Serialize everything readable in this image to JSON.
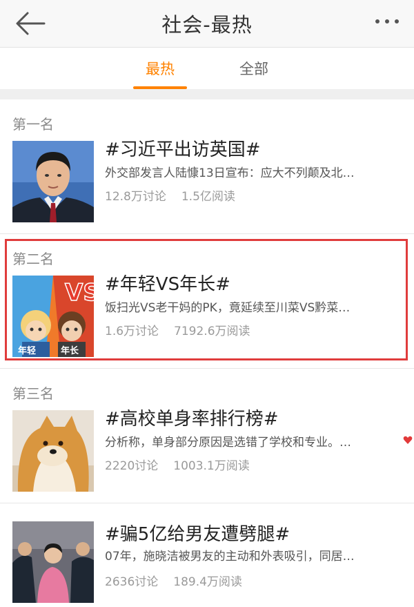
{
  "header": {
    "title": "社会-最热",
    "back_icon": "back-arrow-icon",
    "more_icon": "more-dots-icon"
  },
  "tabs": [
    {
      "label": "最热",
      "active": true
    },
    {
      "label": "全部",
      "active": false
    }
  ],
  "accent_color": "#ff8200",
  "items": [
    {
      "rank": "第一名",
      "topic": "#习近平出访英国#",
      "desc": "外交部发言人陆慷13日宣布：应大不列颠及北…",
      "discussions": "12.8万讨论",
      "reads": "1.5亿阅读"
    },
    {
      "rank": "第二名",
      "topic": "#年轻VS年长#",
      "desc": "饭扫光VS老干妈的PK，竟延续至川菜VS黔菜…",
      "discussions": "1.6万讨论",
      "reads": "7192.6万阅读",
      "thumb_text": {
        "vs": "VS",
        "left": "年轻",
        "right": "年长"
      }
    },
    {
      "rank": "第三名",
      "topic": "#高校单身率排行榜#",
      "desc": "分析称，单身部分原因是选错了学校和专业。…",
      "discussions": "2220讨论",
      "reads": "1003.1万阅读"
    },
    {
      "rank": "",
      "topic": "#骗5亿给男友遭劈腿#",
      "desc": "07年，施晓洁被男友的主动和外表吸引，同居…",
      "discussions": "2636讨论",
      "reads": "189.4万阅读"
    }
  ]
}
